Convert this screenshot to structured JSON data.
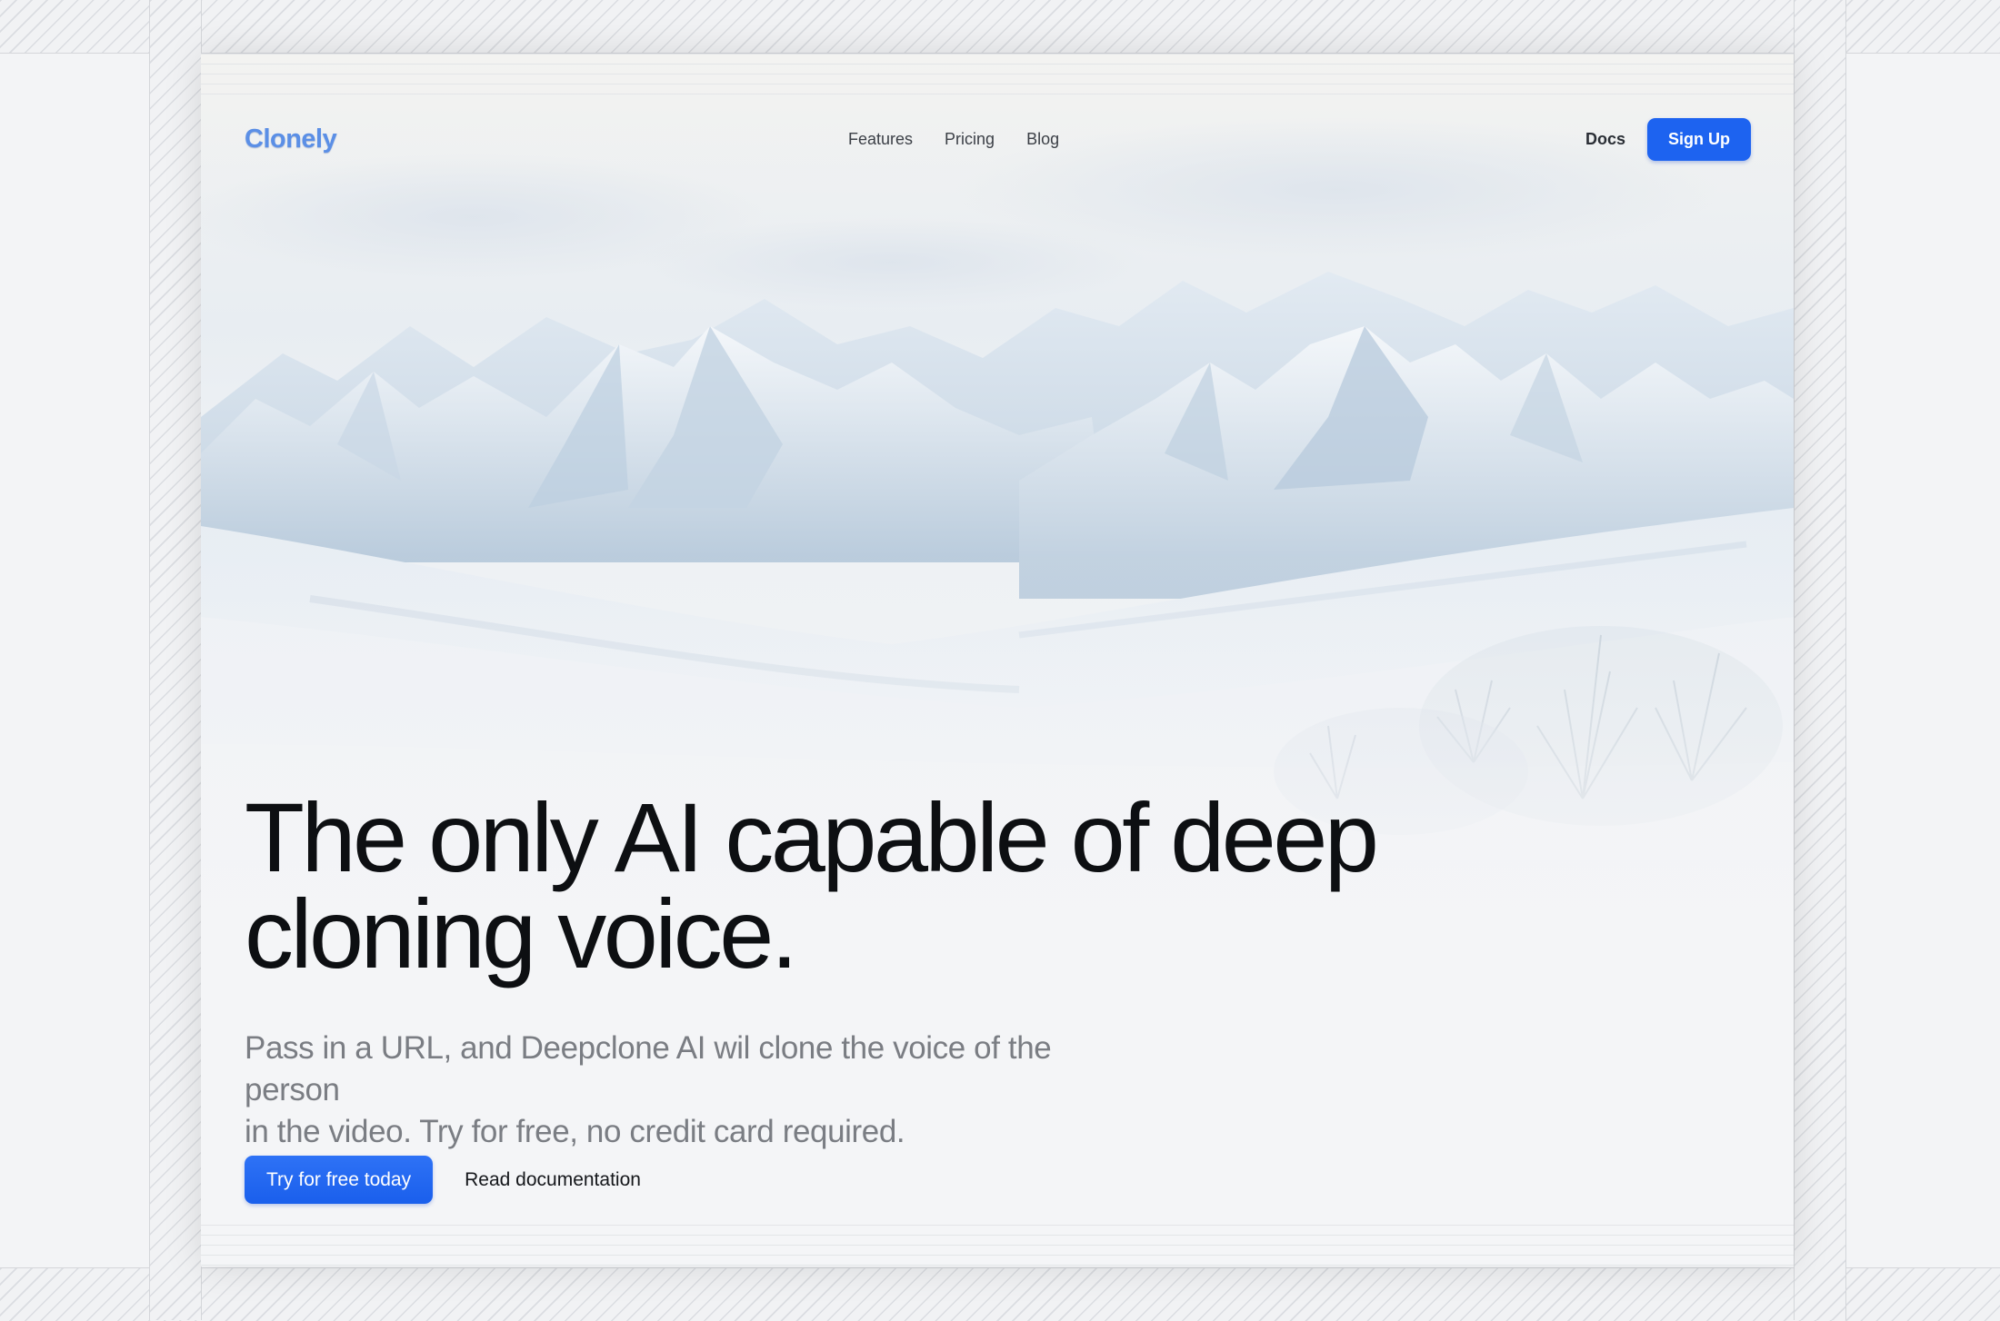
{
  "nav": {
    "logo": "Clonely",
    "links": [
      "Features",
      "Pricing",
      "Blog"
    ],
    "docs_label": "Docs",
    "signup_label": "Sign Up"
  },
  "hero": {
    "title_line1": "The only AI capable of deep",
    "title_line2": "cloning voice.",
    "subtitle_line1": "Pass in a URL, and Deepclone AI wil clone the voice of the person",
    "subtitle_line2": "in the video. Try for free, no credit card required.",
    "primary_cta": "Try for free today",
    "secondary_cta": "Read documentation",
    "background_image": "snowy-mountain-landscape-painting"
  },
  "colors": {
    "accent": "#1d63f0",
    "logo": "#5b8fe6",
    "title": "#0d0f12",
    "subtitle": "#7a7d83",
    "background": "#f4f5f7"
  }
}
